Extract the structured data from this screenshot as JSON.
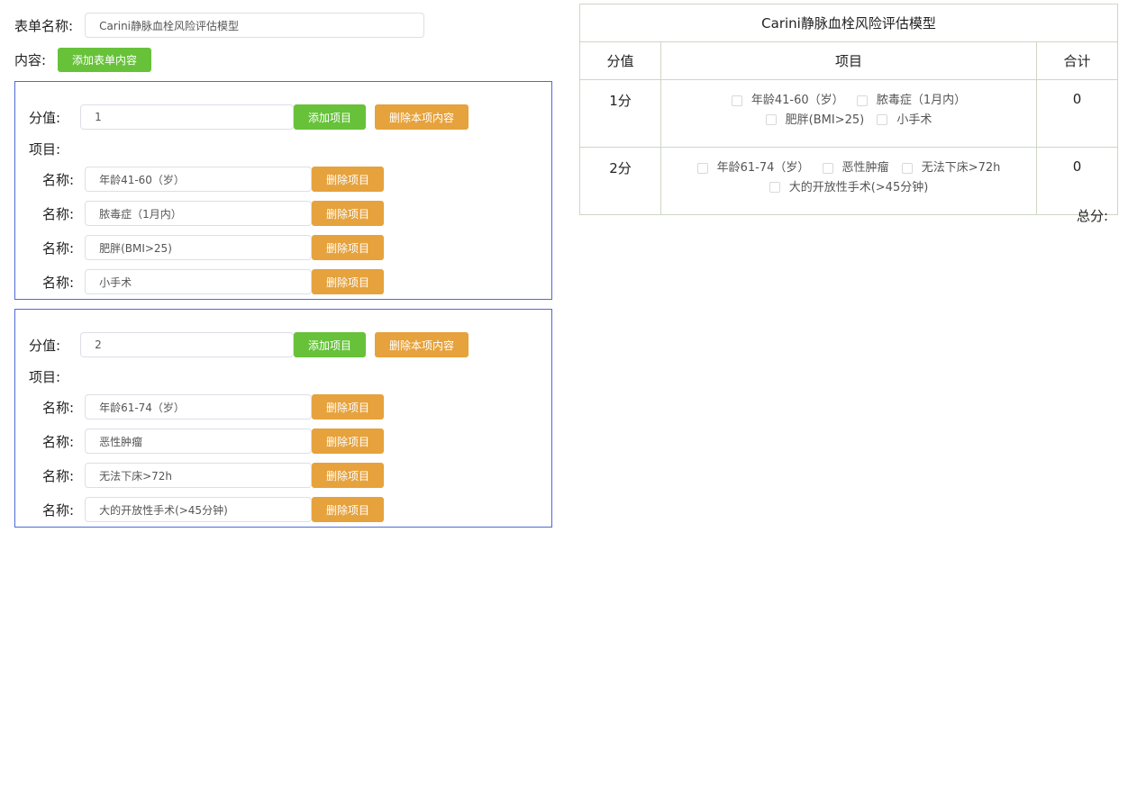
{
  "form": {
    "name_label": "表单名称:",
    "name_value": "Carini静脉血栓风险评估模型",
    "content_label": "内容:",
    "add_content_button": "添加表单内容"
  },
  "blocks": [
    {
      "score_label": "分值:",
      "score_value": "1",
      "add_item_button": "添加项目",
      "delete_block_button": "删除本项内容",
      "items_label": "项目:",
      "items": [
        {
          "label": "名称:",
          "value": "年龄41-60（岁）",
          "delete": "删除项目"
        },
        {
          "label": "名称:",
          "value": "脓毒症（1月内）",
          "delete": "删除项目"
        },
        {
          "label": "名称:",
          "value": "肥胖(BMI>25)",
          "delete": "删除项目"
        },
        {
          "label": "名称:",
          "value": "小手术",
          "delete": "删除项目"
        }
      ]
    },
    {
      "score_label": "分值:",
      "score_value": "2",
      "add_item_button": "添加项目",
      "delete_block_button": "删除本项内容",
      "items_label": "项目:",
      "items": [
        {
          "label": "名称:",
          "value": "年龄61-74（岁）",
          "delete": "删除项目"
        },
        {
          "label": "名称:",
          "value": "恶性肿瘤",
          "delete": "删除项目"
        },
        {
          "label": "名称:",
          "value": "无法下床>72h",
          "delete": "删除项目"
        },
        {
          "label": "名称:",
          "value": "大的开放性手术(>45分钟)",
          "delete": "删除项目"
        }
      ]
    }
  ],
  "preview": {
    "title": "Carini静脉血栓风险评估模型",
    "headers": {
      "score": "分值",
      "items": "项目",
      "total": "合计"
    },
    "rows": [
      {
        "score": "1分",
        "options": [
          "年龄41-60（岁）",
          "脓毒症（1月内）",
          "肥胖(BMI>25)",
          "小手术"
        ],
        "total": "0"
      },
      {
        "score": "2分",
        "options": [
          "年龄61-74（岁）",
          "恶性肿瘤",
          "无法下床>72h",
          "大的开放性手术(>45分钟)"
        ],
        "total": "0"
      }
    ],
    "total_label": "总分:"
  },
  "colors": {
    "green_button": "#67c23a",
    "orange_button": "#e6a23c",
    "block_border": "#4f6ad4",
    "table_border": "#cfd6c4"
  }
}
